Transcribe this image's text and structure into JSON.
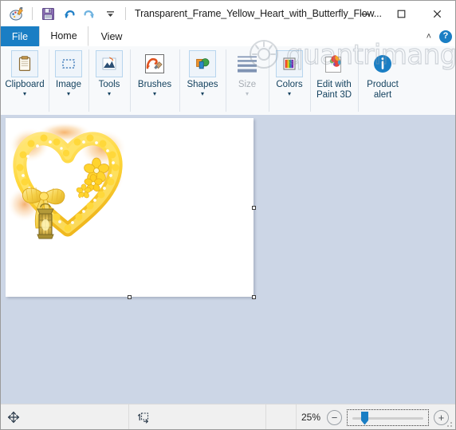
{
  "window": {
    "title": "Transparent_Frame_Yellow_Heart_with_Butterfly_Flow...",
    "app_icon_name": "paint-app-icon",
    "controls": {
      "minimize": "—",
      "maximize": "☐",
      "close": "✕"
    }
  },
  "quick_access": [
    {
      "name": "save-icon",
      "label": "Save"
    },
    {
      "name": "undo-icon",
      "label": "Undo"
    },
    {
      "name": "redo-icon",
      "label": "Redo"
    },
    {
      "name": "customize-qat-icon",
      "label": "Customize Quick Access Toolbar"
    }
  ],
  "tabs": [
    {
      "id": "file",
      "label": "File",
      "active": false,
      "style": "file"
    },
    {
      "id": "home",
      "label": "Home",
      "active": true,
      "style": "normal"
    },
    {
      "id": "view",
      "label": "View",
      "active": false,
      "style": "normal"
    }
  ],
  "tabstrip_right": {
    "collapse_ribbon": "˄",
    "help": "?"
  },
  "ribbon": {
    "groups": [
      {
        "id": "clipboard",
        "label": "Clipboard",
        "icon": "clipboard-icon",
        "caret": "▾",
        "enabled": true
      },
      {
        "id": "image",
        "label": "Image",
        "icon": "select-rectangle-icon",
        "caret": "▾",
        "enabled": true
      },
      {
        "id": "tools",
        "label": "Tools",
        "icon": "pencil-tools-icon",
        "caret": "▾",
        "enabled": true
      },
      {
        "id": "brushes",
        "label": "Brushes",
        "icon": "brush-icon",
        "caret": "▾",
        "enabled": true
      },
      {
        "id": "shapes",
        "label": "Shapes",
        "icon": "shapes-icon",
        "caret": "▾",
        "enabled": true
      },
      {
        "id": "size",
        "label": "Size",
        "icon": "line-size-icon",
        "caret": "▾",
        "enabled": false
      },
      {
        "id": "colors",
        "label": "Colors",
        "icon": "color-palette-icon",
        "caret": "▾",
        "enabled": true
      },
      {
        "id": "paint3d",
        "label": "Edit with\nPaint 3D",
        "label_line1": "Edit with",
        "label_line2": "Paint 3D",
        "icon": "paint3d-icon",
        "caret": "",
        "enabled": true
      },
      {
        "id": "product-alert",
        "label": "Product\nalert",
        "label_line1": "Product",
        "label_line2": "alert",
        "icon": "info-alert-icon",
        "caret": "",
        "enabled": true
      }
    ]
  },
  "watermark": {
    "text": "quantrimang",
    "logo_name": "quantrimang-logo-icon"
  },
  "canvas": {
    "image_name": "yellow-heart-frame-image",
    "alt": "Transparent yellow heart frame with bow, flowers and lantern",
    "selection_handles": [
      "right-middle",
      "bottom-center",
      "bottom-right"
    ]
  },
  "statusbar": {
    "cursor_icon": "cursor-move-icon",
    "cursor_position": "",
    "selection_icon": "selection-size-icon",
    "selection_size": "",
    "zoom_level": "25%",
    "zoom_out": "−",
    "zoom_in": "+",
    "slider_name": "zoom-slider",
    "resize-grip": "resize-grip-icon"
  },
  "colors": {
    "accent": "#1a7ec4",
    "ribbon_bg": "#f7f9fb",
    "workarea_bg": "#ccd6e6",
    "statusbar_bg": "#f0f0f0",
    "tile_border": "#b7d5ee",
    "label_text": "#14425f"
  }
}
